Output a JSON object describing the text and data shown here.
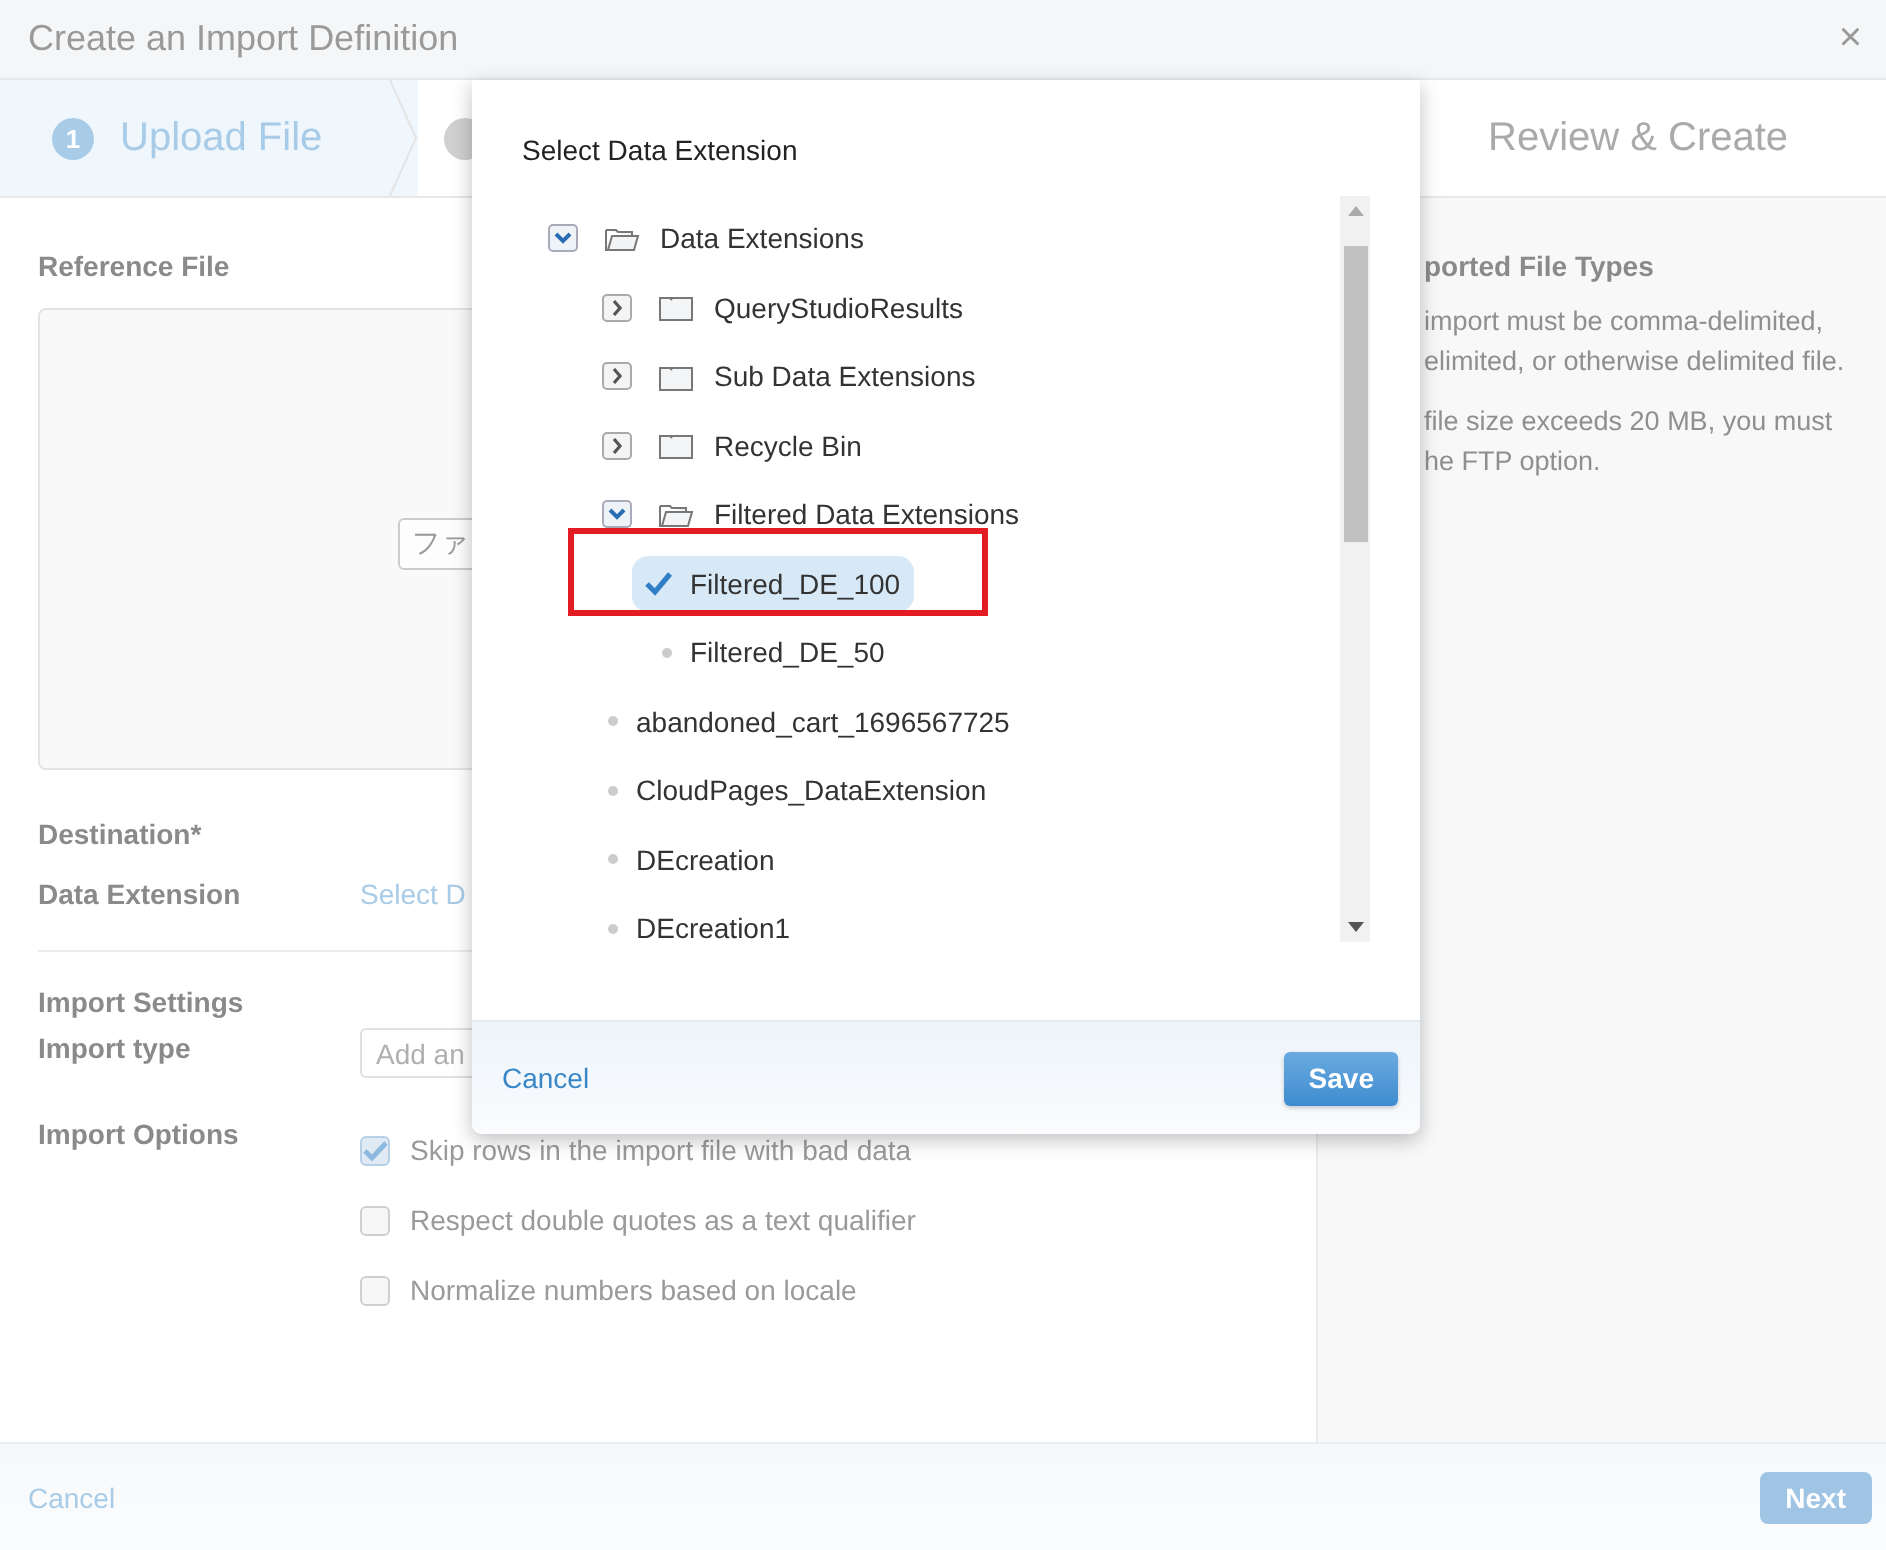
{
  "window": {
    "title": "Create an Import Definition",
    "close": "×"
  },
  "steps": [
    {
      "number": "1",
      "label": "Upload File",
      "selected": true
    },
    {
      "selected": false
    },
    {
      "label": "Review & Create",
      "selected": false
    }
  ],
  "reference_file": {
    "heading": "Reference File",
    "file_button": "ファ"
  },
  "destination": {
    "heading": "Destination*",
    "label": "Data Extension",
    "link": "Select D"
  },
  "import_settings": {
    "heading": "Import Settings",
    "type_label": "Import type",
    "type_field": {
      "placeholder": "Add an"
    },
    "options_label": "Import Options",
    "options": [
      {
        "label": "Skip rows in the import file with bad data",
        "checked": true
      },
      {
        "label": "Respect double quotes as a text qualifier",
        "checked": false
      },
      {
        "label": "Normalize numbers based on locale",
        "checked": false
      }
    ]
  },
  "info_panel": {
    "heading": "ported File Types",
    "paragraphs": [
      [
        "import must be comma-delimited,",
        "elimited, or otherwise delimited file."
      ],
      [
        "file size exceeds 20 MB, you must",
        "he FTP option."
      ]
    ]
  },
  "footer": {
    "cancel": "Cancel",
    "next": {
      "label": "Next",
      "disabled": true
    }
  },
  "dialog": {
    "title": "Select Data Extension",
    "tree": [
      {
        "kind": "folder",
        "label": "Data Extensions",
        "expanded": true,
        "children": [
          {
            "kind": "folder",
            "label": "QueryStudioResults",
            "expanded": false
          },
          {
            "kind": "folder",
            "label": "Sub Data Extensions",
            "expanded": false
          },
          {
            "kind": "folder",
            "label": "Recycle Bin",
            "expanded": false
          },
          {
            "kind": "folder",
            "label": "Filtered Data Extensions",
            "expanded": true,
            "children": [
              {
                "kind": "item",
                "label": "Filtered_DE_100",
                "selected": true,
                "highlighted": true
              },
              {
                "kind": "item",
                "label": "Filtered_DE_50",
                "selected": false,
                "highlighted": false
              }
            ]
          },
          {
            "kind": "item",
            "label": "abandoned_cart_1696567725",
            "selected": false,
            "highlighted": false
          },
          {
            "kind": "item",
            "label": "CloudPages_DataExtension",
            "selected": false,
            "highlighted": false
          },
          {
            "kind": "item",
            "label": "DEcreation",
            "selected": false,
            "highlighted": false
          },
          {
            "kind": "item",
            "label": "DEcreation1",
            "selected": false,
            "highlighted": false
          }
        ]
      }
    ],
    "cancel": "Cancel",
    "save": "Save"
  }
}
